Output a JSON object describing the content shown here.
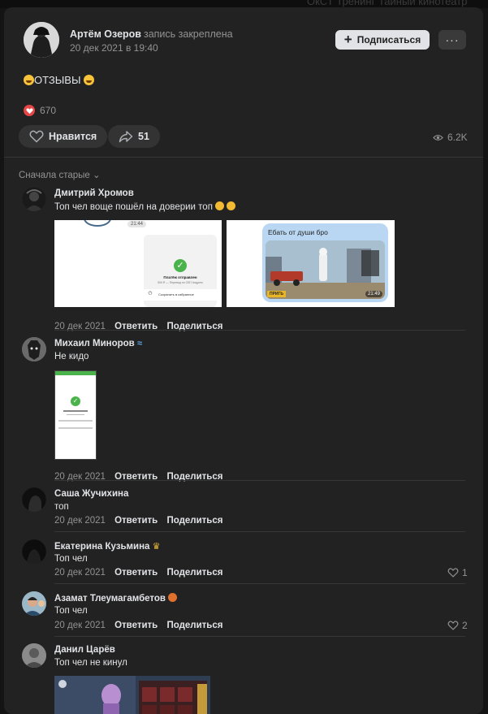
{
  "post": {
    "author_name": "Артём Озеров",
    "pinned_text": "запись закреплена",
    "date": "20 дек 2021 в 19:40",
    "subscribe_label": "Подписаться",
    "more_label": "···",
    "text": "ОТЗЫВЫ",
    "reactions_count": "670",
    "like_label": "Нравится",
    "shares_count": "51",
    "views_count": "6.2K"
  },
  "comments_sort": "Сначала старые",
  "actions": {
    "reply": "Ответить",
    "share": "Поделиться"
  },
  "comments": [
    {
      "author": "Дмитрий Хромов",
      "text": "Топ чел воще пошёл на доверии топ",
      "date": "20 дек 2021",
      "likes": ""
    },
    {
      "author": "Михаил Миноров",
      "text": "Не кидо",
      "date": "20 дек 2021",
      "likes": ""
    },
    {
      "author": "Саша Жучихина",
      "text": "топ",
      "date": "20 дек 2021",
      "likes": ""
    },
    {
      "author": "Екатерина Кузьмина",
      "text": "Топ чел",
      "date": "20 дек 2021",
      "likes": "1"
    },
    {
      "author": "Азамат Тлеумагамбетов",
      "text": "Топ чел",
      "date": "20 дек 2021",
      "likes": "2"
    },
    {
      "author": "Данил Царёв",
      "text": "Топ чел не кинул",
      "date": "",
      "likes": ""
    }
  ],
  "attachments": {
    "c1_img1": {
      "time": "21:44",
      "title": "Платёж отправлен",
      "subtitle": "500 ₽ — Перевод по СБП Андрею",
      "row": "Сохранить в избранное"
    },
    "c1_img2": {
      "caption": "Ебать от души бро",
      "time": "21:49",
      "badge": "ПРИГЬ"
    }
  },
  "colors": {
    "card": "#222222",
    "accent_red": "#e64646",
    "check_green": "#4bb34b",
    "bubble_blue": "#b9d7f2"
  }
}
